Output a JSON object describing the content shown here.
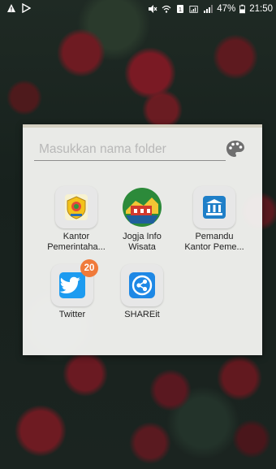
{
  "status_bar": {
    "battery_percent": "47%",
    "time": "21:50",
    "left_icons": [
      "warning-icon",
      "play-icon"
    ],
    "right_icons": [
      "mute-icon",
      "wifi-icon",
      "sim-icon",
      "signal-icon"
    ]
  },
  "folder": {
    "name_placeholder": "Masukkan nama folder",
    "palette_icon": "palette-icon",
    "apps": [
      {
        "label_line1": "Kantor",
        "label_line2": "Pemerintaha...",
        "icon": "kantor-pemerintahan-icon"
      },
      {
        "label_line1": "Jogja Info",
        "label_line2": "Wisata",
        "icon": "jogja-info-wisata-icon"
      },
      {
        "label_line1": "Pemandu",
        "label_line2": "Kantor Peme...",
        "icon": "pemandu-kantor-icon"
      },
      {
        "label_line1": "Twitter",
        "label_line2": "",
        "icon": "twitter-icon",
        "badge": "20"
      },
      {
        "label_line1": "SHAREit",
        "label_line2": "",
        "icon": "shareit-icon"
      }
    ]
  },
  "colors": {
    "twitter_blue": "#1d9bf0",
    "shareit_blue": "#1e88e5",
    "badge_orange": "#f07a3a",
    "folder_bg": "#f6f6f4"
  }
}
